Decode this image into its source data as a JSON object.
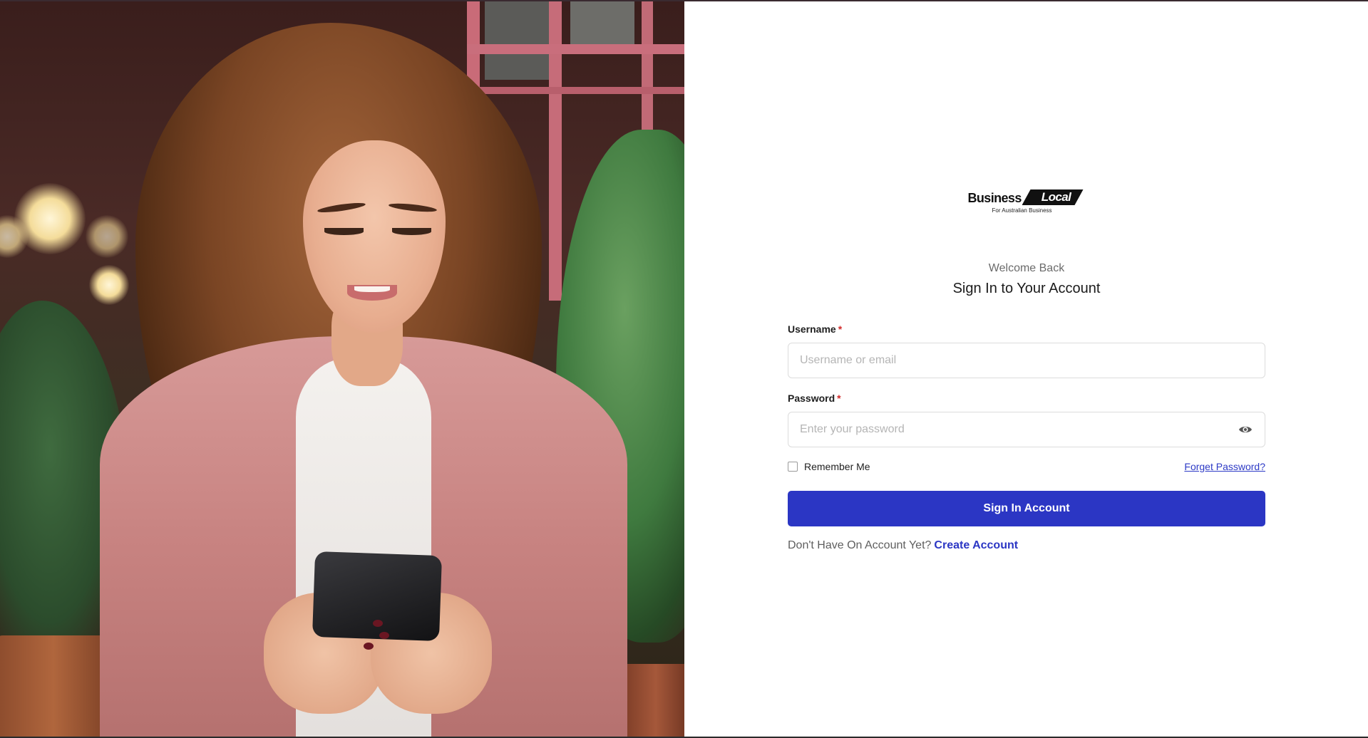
{
  "brand": {
    "name_part1": "Business",
    "name_part2": "Local",
    "tagline": "For Australian Business"
  },
  "header": {
    "welcome": "Welcome Back",
    "title": "Sign In to Your Account"
  },
  "form": {
    "username": {
      "label": "Username",
      "required_mark": "*",
      "value": "",
      "placeholder": "Username or email"
    },
    "password": {
      "label": "Password",
      "required_mark": "*",
      "value": "",
      "placeholder": "Enter your password",
      "toggle_icon": "eye-icon"
    },
    "remember_me": {
      "label": "Remember Me",
      "checked": false
    },
    "forgot_link": "Forget Password?",
    "submit_label": "Sign In Account",
    "signup_prompt": "Don't Have On Account Yet?",
    "signup_link": "Create Account"
  },
  "colors": {
    "primary": "#2b36c4",
    "required": "#d22a2a",
    "muted_text": "#6b6b6b"
  },
  "hero_image": {
    "icon": "photo-woman-with-phone"
  }
}
